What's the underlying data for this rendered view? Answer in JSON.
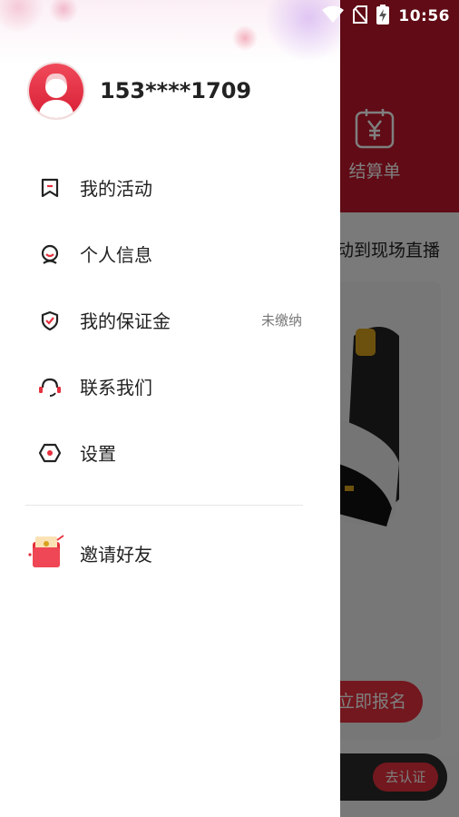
{
  "status_bar": {
    "time": "10:56"
  },
  "background_app": {
    "settlement_label": "结算单",
    "settlement_icon": "yuan-calendar-icon",
    "live_text": "活动到现场直播",
    "signup_button": "立即报名",
    "verify_button": "去认证"
  },
  "drawer": {
    "phone": "153****1709",
    "menu": [
      {
        "label": "我的活动",
        "icon": "bookmark-icon"
      },
      {
        "label": "个人信息",
        "icon": "person-icon"
      },
      {
        "label": "我的保证金",
        "icon": "shield-check-icon",
        "status": "未缴纳"
      },
      {
        "label": "联系我们",
        "icon": "headset-icon"
      },
      {
        "label": "设置",
        "icon": "hexagon-settings-icon"
      }
    ],
    "invite": {
      "label": "邀请好友",
      "icon": "red-envelope-icon"
    }
  },
  "colors": {
    "accent": "#e5303d",
    "brand_red": "#c0162a"
  }
}
